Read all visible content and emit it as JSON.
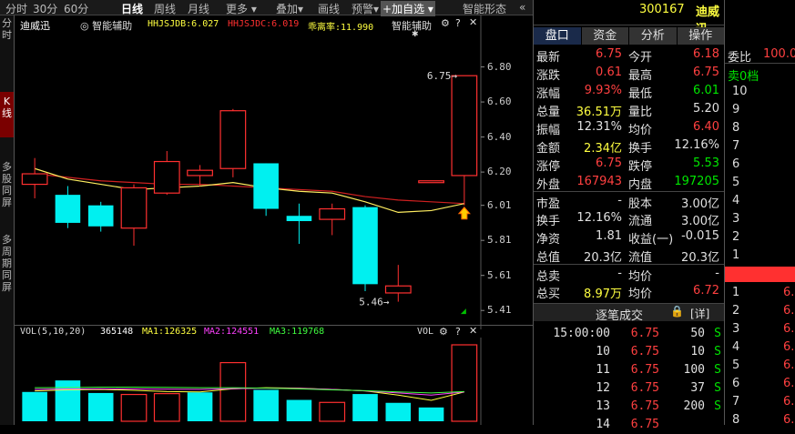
{
  "toolbar": {
    "items": [
      "分时",
      "30分",
      "60分",
      "日线",
      "周线",
      "月线",
      "更多",
      "叠加",
      "画线",
      "预警",
      "加自选",
      "智能形态"
    ],
    "active": "日线",
    "nav_arrow": "«"
  },
  "left_sidebar": {
    "items": [
      "分时",
      "K线",
      "多股同屏",
      "多周期同屏"
    ],
    "active": "K线"
  },
  "kline_header": {
    "stock_name": "迪威迅",
    "assist_label": "智能辅助",
    "hhjsjdb": "HHJSJDB:6.027",
    "hhjsjdc": "HHJSJDC:6.019",
    "deviation": "乖离率:11.990",
    "assist_right": "智能辅助"
  },
  "chart_data": {
    "type": "candlestick",
    "price_axis": {
      "ticks": [
        "6.80",
        "6.60",
        "6.40",
        "6.20",
        "6.01",
        "5.81",
        "5.61",
        "5.41"
      ],
      "min": 5.38,
      "max": 6.86
    },
    "candles": [
      {
        "o": 6.13,
        "h": 6.28,
        "l": 6.05,
        "c": 6.19
      },
      {
        "o": 6.07,
        "h": 6.12,
        "l": 5.88,
        "c": 5.91
      },
      {
        "o": 6.01,
        "h": 6.03,
        "l": 5.86,
        "c": 5.89
      },
      {
        "o": 5.88,
        "h": 6.13,
        "l": 5.78,
        "c": 6.11
      },
      {
        "o": 6.08,
        "h": 6.32,
        "l": 6.07,
        "c": 6.26
      },
      {
        "o": 6.18,
        "h": 6.24,
        "l": 6.12,
        "c": 6.21
      },
      {
        "o": 6.22,
        "h": 6.56,
        "l": 6.17,
        "c": 6.55
      },
      {
        "o": 6.25,
        "h": 6.25,
        "l": 5.95,
        "c": 5.99
      },
      {
        "o": 5.95,
        "h": 6.02,
        "l": 5.79,
        "c": 5.92
      },
      {
        "o": 5.93,
        "h": 6.02,
        "l": 5.84,
        "c": 5.99
      },
      {
        "o": 6.0,
        "h": 6.01,
        "l": 5.52,
        "c": 5.56
      },
      {
        "o": 5.51,
        "h": 5.67,
        "l": 5.46,
        "c": 5.55
      },
      {
        "o": 6.15,
        "h": 6.15,
        "l": 6.15,
        "c": 6.15
      },
      {
        "o": 6.18,
        "h": 6.75,
        "l": 6.01,
        "c": 6.75
      }
    ],
    "ma_line": [
      6.19,
      6.17,
      6.15,
      6.14,
      6.13,
      6.13,
      6.12,
      6.11,
      6.1,
      6.09,
      6.06,
      6.04,
      6.03,
      6.02
    ],
    "avg_line": [
      6.22,
      6.16,
      6.13,
      6.1,
      6.11,
      6.12,
      6.14,
      6.11,
      6.09,
      6.08,
      6.03,
      5.97,
      5.98,
      6.02
    ],
    "high_label": "6.75",
    "low_label": "5.46",
    "volume": {
      "header": {
        "vol_label": "VOL(5,10,20)",
        "vol": "365148",
        "ma1": "MA1:126325",
        "ma2": "MA2:124551",
        "ma3": "MA3:119768",
        "right_label": "VOL"
      },
      "axis_ticks": [
        "24.34",
        "12.17",
        "X万"
      ],
      "max": 36.5,
      "bars": [
        {
          "v": 14.0,
          "up": false
        },
        {
          "v": 19.5,
          "up": false
        },
        {
          "v": 13.5,
          "up": false
        },
        {
          "v": 12.8,
          "up": true
        },
        {
          "v": 13.2,
          "up": true
        },
        {
          "v": 13.8,
          "up": false
        },
        {
          "v": 28.0,
          "up": true
        },
        {
          "v": 15.0,
          "up": false
        },
        {
          "v": 10.2,
          "up": false
        },
        {
          "v": 9.0,
          "up": true
        },
        {
          "v": 13.0,
          "up": false
        },
        {
          "v": 8.8,
          "up": false
        },
        {
          "v": 6.6,
          "up": false
        },
        {
          "v": 36.5,
          "up": true
        }
      ],
      "ma1": [
        14.5,
        15.0,
        15.2,
        14.8,
        14.2,
        14.0,
        15.5,
        16.0,
        15.8,
        15.2,
        14.5,
        12.5,
        10.0,
        14.0
      ],
      "ma2": [
        15.2,
        15.4,
        15.5,
        15.4,
        15.3,
        15.2,
        15.6,
        15.8,
        15.7,
        15.2,
        14.5,
        13.5,
        12.5,
        14.0
      ],
      "ma3": [
        16.0,
        16.1,
        16.3,
        16.3,
        16.2,
        16.0,
        16.0,
        15.8,
        15.5,
        15.0,
        14.6,
        14.0,
        13.5,
        14.2
      ]
    }
  },
  "right_panel": {
    "code": "300167",
    "name": "迪威迅",
    "tabs": [
      "盘口",
      "资金",
      "分析",
      "操作"
    ],
    "active_tab": "盘口",
    "quotes": [
      {
        "l1": "最新",
        "v1": "6.75",
        "c1": "red",
        "l2": "今开",
        "v2": "6.18",
        "c2": "red"
      },
      {
        "l1": "涨跌",
        "v1": "0.61",
        "c1": "red",
        "l2": "最高",
        "v2": "6.75",
        "c2": "red"
      },
      {
        "l1": "涨幅",
        "v1": "9.93%",
        "c1": "red",
        "l2": "最低",
        "v2": "6.01",
        "c2": "green"
      },
      {
        "l1": "总量",
        "v1": "36.51万",
        "c1": "yellow",
        "l2": "量比",
        "v2": "5.20",
        "c2": "white"
      },
      {
        "l1": "振幅",
        "v1": "12.31%",
        "c1": "white",
        "l2": "均价",
        "v2": "6.40",
        "c2": "red"
      },
      {
        "l1": "金额",
        "v1": "2.34亿",
        "c1": "yellow",
        "l2": "换手",
        "v2": "12.16%",
        "c2": "white"
      },
      {
        "l1": "涨停",
        "v1": "6.75",
        "c1": "red",
        "l2": "跌停",
        "v2": "5.53",
        "c2": "green"
      },
      {
        "l1": "外盘",
        "v1": "167943",
        "c1": "red",
        "l2": "内盘",
        "v2": "197205",
        "c2": "green"
      },
      {
        "l1": "市盈",
        "v1": "-",
        "c1": "white",
        "l2": "股本",
        "v2": "3.00亿",
        "c2": "white"
      },
      {
        "l1": "换手",
        "v1": "12.16%",
        "c1": "white",
        "l2": "流通",
        "v2": "3.00亿",
        "c2": "white"
      },
      {
        "l1": "净资",
        "v1": "1.81",
        "c1": "white",
        "l2": "收益(一)",
        "v2": "-0.015",
        "c2": "white"
      },
      {
        "l1": "总值",
        "v1": "20.3亿",
        "c1": "white",
        "l2": "流值",
        "v2": "20.3亿",
        "c2": "white"
      },
      {
        "l1": "总卖",
        "v1": "-",
        "c1": "white",
        "l2": "均价",
        "v2": "-",
        "c2": "white"
      },
      {
        "l1": "总买",
        "v1": "8.97万",
        "c1": "yellow",
        "l2": "均价",
        "v2": "6.72",
        "c2": "red"
      }
    ],
    "trades_title": "逐笔成交",
    "trades_detail": "[详]",
    "trades": [
      {
        "t": "15:00:00",
        "p": "6.75",
        "v": "50",
        "s": "S"
      },
      {
        "t": "10",
        "p": "6.75",
        "v": "10",
        "s": "S"
      },
      {
        "t": "11",
        "p": "6.75",
        "v": "100",
        "s": "S"
      },
      {
        "t": "12",
        "p": "6.75",
        "v": "37",
        "s": "S"
      },
      {
        "t": "13",
        "p": "6.75",
        "v": "200",
        "s": "S"
      },
      {
        "t": "14",
        "p": "6.75",
        "v": "",
        "s": ""
      }
    ]
  },
  "orderbook": {
    "wei_bi_label": "委比",
    "wei_bi": "100.0",
    "sell_zero": "卖0档",
    "sell_levels": [
      "10",
      "9",
      "8",
      "7",
      "6",
      "5",
      "4",
      "3",
      "2",
      "1"
    ],
    "buy_levels": [
      "1",
      "2",
      "3",
      "4",
      "5",
      "6",
      "7",
      "8",
      "9",
      "10"
    ],
    "buy_price": "6."
  }
}
